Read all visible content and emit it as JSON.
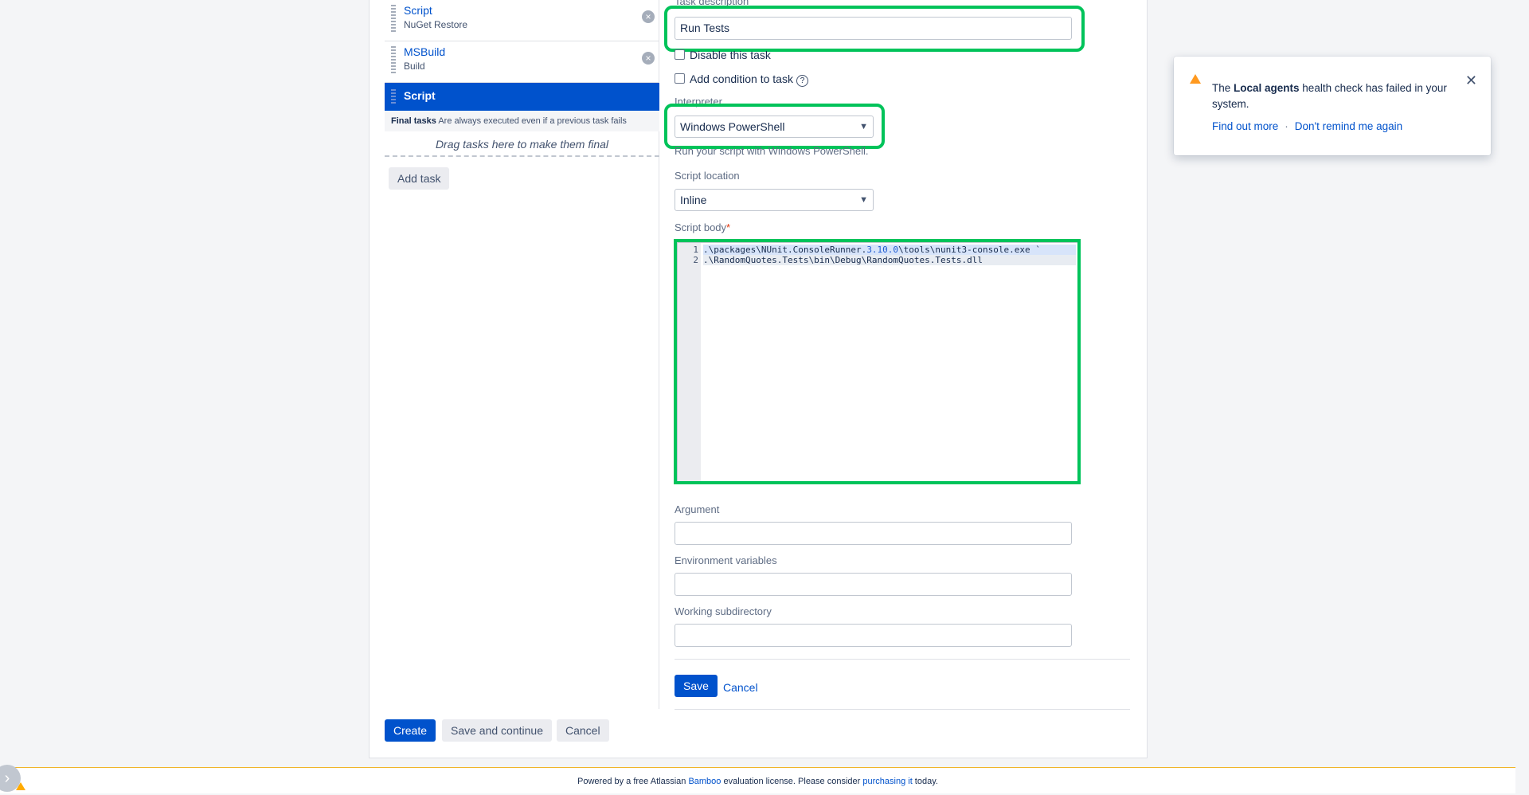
{
  "tasks": [
    {
      "name": "Script",
      "subtitle": "NuGet Restore"
    },
    {
      "name": "MSBuild",
      "subtitle": "Build"
    },
    {
      "name": "Script",
      "subtitle": ""
    }
  ],
  "final_tasks": {
    "title": "Final tasks",
    "note": "Are always executed even if a previous task fails"
  },
  "drag_hint": "Drag tasks here to make them final",
  "add_task_label": "Add task",
  "form": {
    "task_description_label": "Task description",
    "task_description_value": "Run Tests",
    "disable_label": "Disable this task",
    "condition_label": "Add condition to task",
    "interpreter_label": "Interpreter",
    "interpreter_value": "Windows PowerShell",
    "interpreter_help": "Run your script with Windows PowerShell.",
    "script_location_label": "Script location",
    "script_location_value": "Inline",
    "script_body_label": "Script body",
    "required_mark": "*",
    "script_lines": [
      {
        "num": "1",
        "pre": ".\\packages\\NUnit.ConsoleRunner.",
        "ver": "3.10.0",
        "post": "\\tools\\nunit3-console.exe `"
      },
      {
        "num": "2",
        "text": ".\\RandomQuotes.Tests\\bin\\Debug\\RandomQuotes.Tests.dll"
      }
    ],
    "argument_label": "Argument",
    "env_label": "Environment variables",
    "workdir_label": "Working subdirectory",
    "save_label": "Save",
    "cancel_label": "Cancel"
  },
  "bottom_buttons": {
    "create": "Create",
    "save_continue": "Save and continue",
    "cancel": "Cancel"
  },
  "notification": {
    "pre": "The ",
    "bold": "Local agents",
    "post": " health check has failed in your system.",
    "find_out": "Find out more",
    "separator": "·",
    "dont_remind": "Don't remind me again",
    "close": "✕"
  },
  "footer": {
    "pre": "Powered by a free Atlassian ",
    "bamboo": "Bamboo",
    "mid": " evaluation license. Please consider ",
    "purchasing": "purchasing it",
    "post": " today."
  },
  "colors": {
    "accent": "#0052cc",
    "highlight": "#00c35a",
    "warning": "#ff991f"
  }
}
